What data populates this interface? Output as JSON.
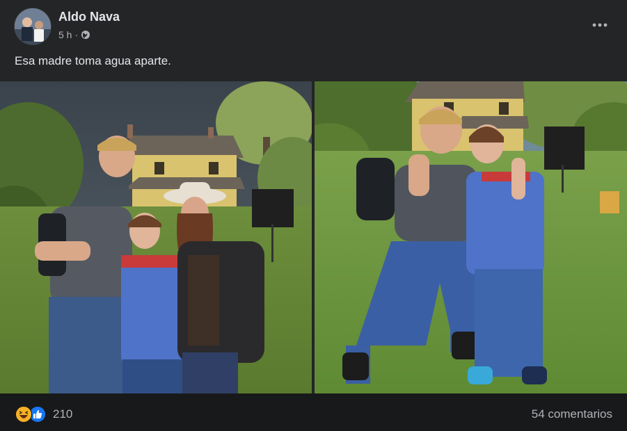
{
  "post": {
    "author": "Aldo Nava",
    "time": "5 h",
    "separator": "·",
    "audience_icon": "globe-icon",
    "text": "Esa madre toma agua aparte.",
    "more_icon": "more-options-icon"
  },
  "photos": [
    {
      "name": "photo-left",
      "description_icon": "photo"
    },
    {
      "name": "photo-right",
      "description_icon": "photo"
    }
  ],
  "footer": {
    "reaction_icons": [
      "haha-icon",
      "like-icon"
    ],
    "reaction_count": "210",
    "comments": "54 comentarios"
  },
  "colors": {
    "background": "#242526",
    "footer_bg": "#18191a",
    "text_primary": "#e4e6eb",
    "text_secondary": "#b0b3b8",
    "like_blue": "#1877f2",
    "haha_yellow": "#f7b125"
  }
}
